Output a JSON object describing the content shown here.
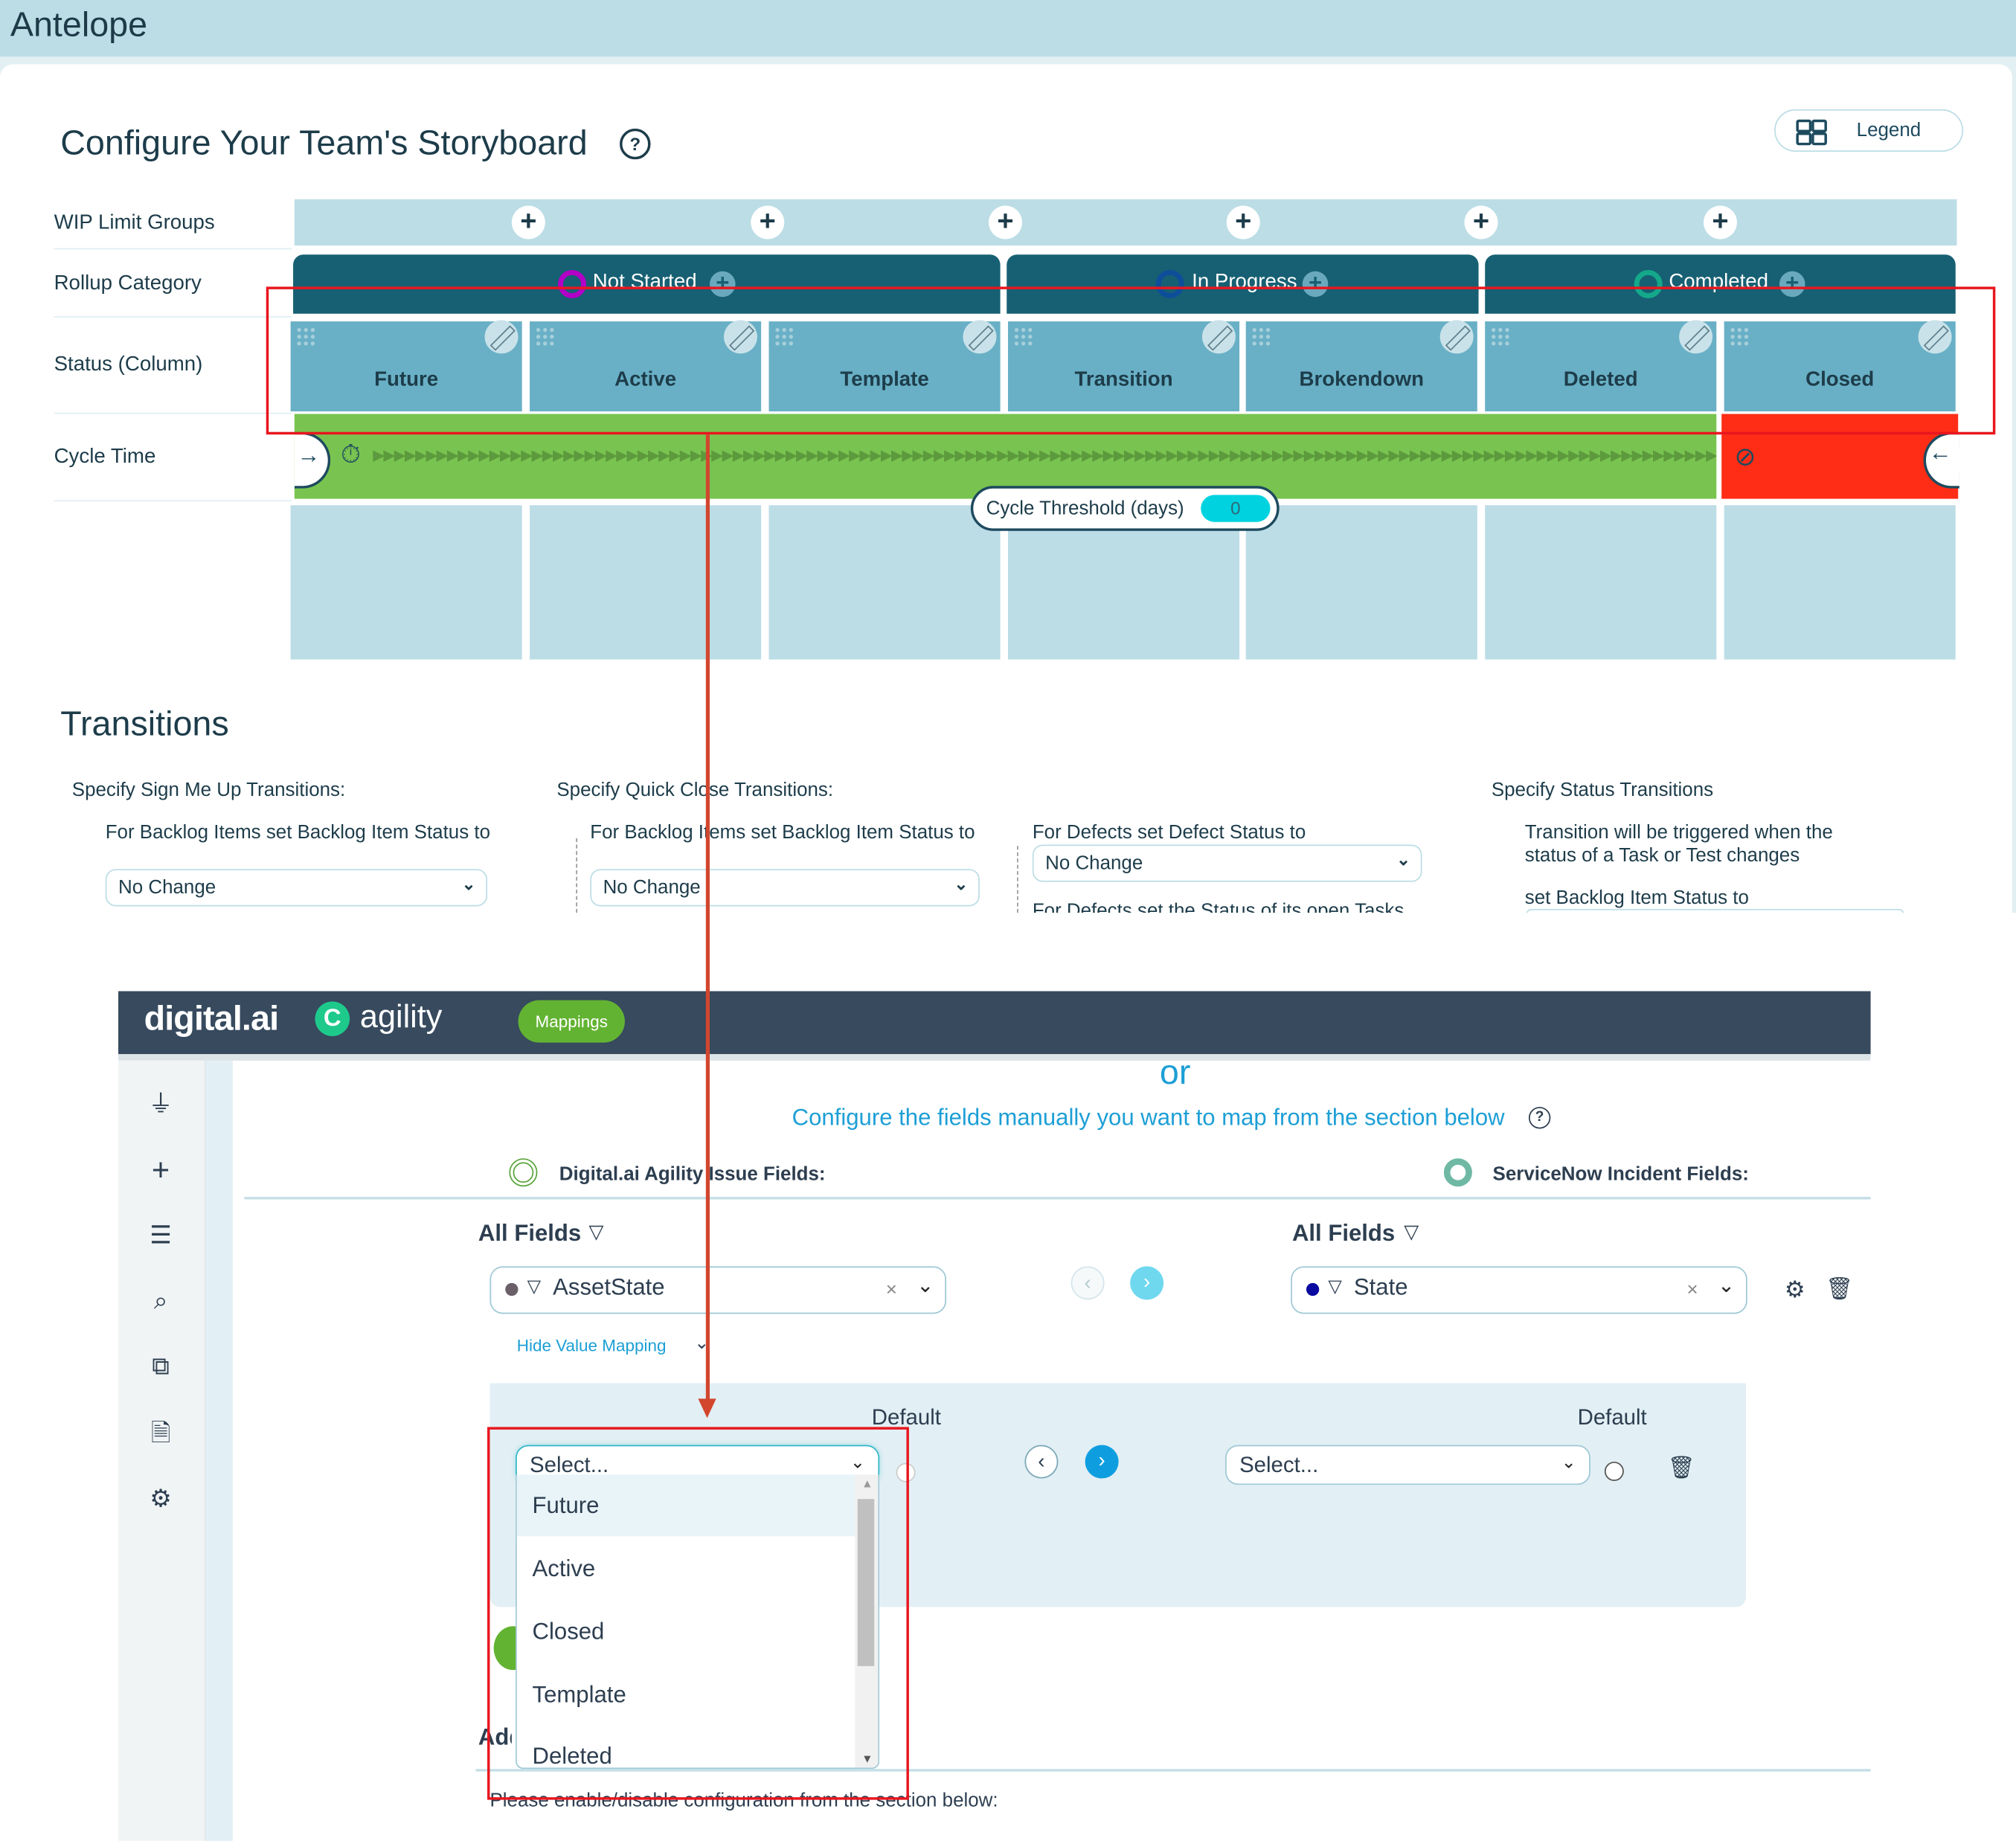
{
  "storyboard": {
    "app_title": "Antelope",
    "page_title": "Configure Your Team's Storyboard",
    "help_icon": "question-circle-icon",
    "legend_label": "Legend",
    "row_labels": {
      "wip": "WIP Limit Groups",
      "rollup": "Rollup Category",
      "status": "Status (Column)",
      "cycle": "Cycle Time"
    },
    "wip_add_icon": "plus-icon",
    "rollup_categories": [
      {
        "label": "Not Started",
        "color": "#b300c7"
      },
      {
        "label": "In Progress",
        "color": "#0d4e9a"
      },
      {
        "label": "Completed",
        "color": "#13a98a"
      }
    ],
    "statuses": [
      "Future",
      "Active",
      "Template",
      "Transition",
      "Brokendown",
      "Deleted",
      "Closed"
    ],
    "cycle_time": {
      "threshold_label": "Cycle Threshold (days)",
      "threshold_value": "0",
      "arrows": "▶▶▶▶▶▶▶▶▶▶▶▶▶▶▶▶▶▶▶▶▶▶▶▶▶▶▶▶▶▶▶▶▶▶▶▶▶▶▶▶▶▶▶▶▶▶▶▶▶▶▶▶▶▶▶▶▶▶▶▶▶▶▶▶▶▶▶▶▶▶▶▶▶▶▶▶▶▶▶▶▶▶▶▶▶▶▶▶▶▶▶▶▶▶▶▶▶▶▶▶▶▶▶▶▶▶▶▶▶▶▶▶▶▶▶▶▶▶▶▶▶▶▶▶▶▶▶▶▶▶▶"
    },
    "colors": {
      "cycle_in": "#79c450",
      "cycle_out": "#ff2d16",
      "rollup_bg": "#176073",
      "status_bg": "#69b0c6"
    },
    "transitions": {
      "title": "Transitions",
      "sign_me_up": {
        "heading": "Specify Sign Me Up Transitions:",
        "label": "For Backlog Items set Backlog Item Status to",
        "value": "No Change"
      },
      "quick_close": {
        "heading": "Specify Quick Close Transitions:",
        "label": "For Backlog Items set Backlog Item Status to",
        "value": "No Change",
        "defect_label": "For Defects set Defect Status to",
        "defect_value": "No Change",
        "defect_tasks_label": "For Defects set the Status of its open Tasks"
      },
      "status": {
        "heading": "Specify Status Transitions",
        "description": "Transition will be triggered when the status of a Task or Test changes",
        "label": "set Backlog Item Status to"
      }
    }
  },
  "mapping": {
    "brand": "digital.ai",
    "product": "agility",
    "mappings_label": "Mappings",
    "nav_icons": [
      "plug-icon",
      "plus-icon",
      "list-icon",
      "search-icon",
      "link-icon",
      "document-check-icon",
      "gear-icon"
    ],
    "or_text": "or",
    "configure_text": "Configure the fields manually you want to map from the section below",
    "left_source_label": "Digital.ai Agility Issue Fields:",
    "right_source_label": "ServiceNow Incident Fields:",
    "all_fields_label": "All Fields",
    "left_field": {
      "value": "AssetState",
      "dot_color": "#6b6068"
    },
    "right_field": {
      "value": "State",
      "dot_color": "#0a0aa0"
    },
    "hide_value_mapping": "Hide Value Mapping",
    "default_label": "Default",
    "left_select_placeholder": "Select...",
    "right_select_placeholder": "Select...",
    "dropdown_options": [
      "Future",
      "Active",
      "Closed",
      "Template",
      "Deleted"
    ],
    "dropdown_highlighted": "Future",
    "add_label_partial": "Add",
    "enable_text": "Please enable/disable configuration from the section below:"
  }
}
